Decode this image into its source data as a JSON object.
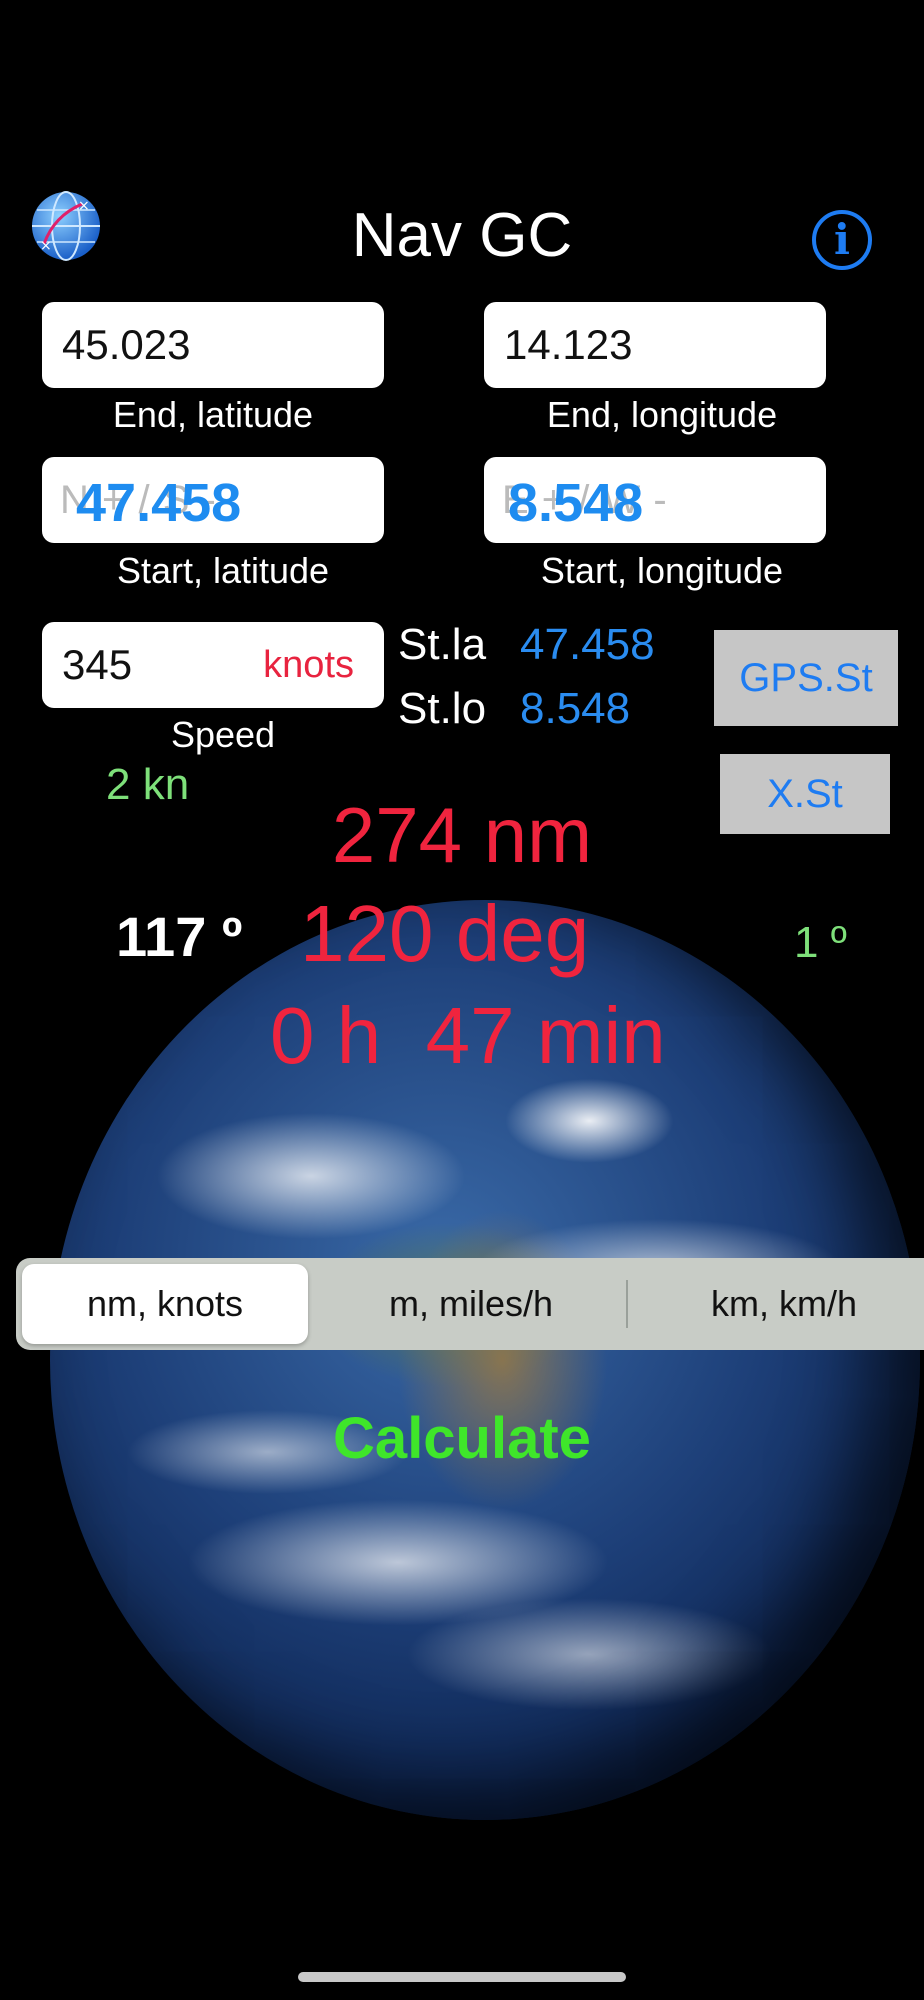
{
  "header": {
    "title": "Nav GC",
    "info_glyph": "i",
    "logo_icon": "globe-route-icon"
  },
  "end_latitude": {
    "value": "45.023",
    "caption": "End, latitude"
  },
  "end_longitude": {
    "value": "14.123",
    "caption": "End, longitude"
  },
  "start_latitude": {
    "placeholder": "N + / S -",
    "value": "47.458",
    "caption": "Start, latitude"
  },
  "start_longitude": {
    "placeholder": "E + / W -",
    "value": "8.548",
    "caption": "Start, longitude"
  },
  "speed": {
    "value": "345",
    "unit": "knots",
    "caption": "Speed",
    "gps_speed": "2 kn"
  },
  "current_position": {
    "lat_label": "St.la",
    "lat_value": "47.458",
    "lon_label": "St.lo",
    "lon_value": "8.548"
  },
  "buttons": {
    "gps_start": "GPS.St",
    "x_start": "X.St",
    "calculate": "Calculate"
  },
  "results": {
    "distance": "274 nm",
    "course": "120 deg",
    "time": "0 h  47 min",
    "heading": "117 º",
    "deviation": "1 º"
  },
  "units": {
    "options": [
      "nm, knots",
      "m, miles/h",
      "km, km/h"
    ],
    "selected_index": 0
  },
  "colors": {
    "accent_blue": "#1e7cf2",
    "result_red": "#f0243e",
    "calculate_green": "#3fe62a",
    "gps_green": "#7ee07a"
  }
}
